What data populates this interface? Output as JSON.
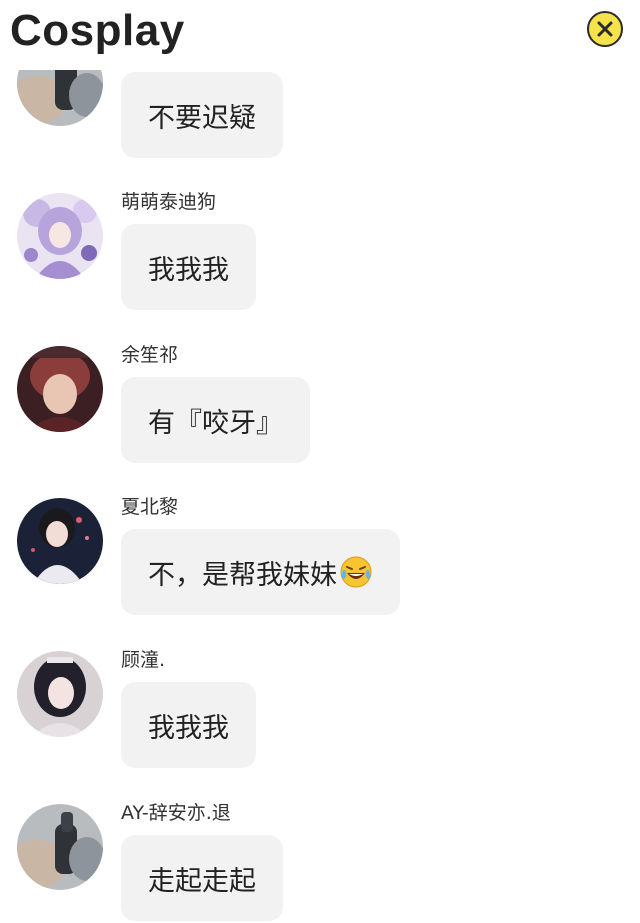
{
  "header": {
    "title": "Cosplay",
    "close_icon": "close-circle-icon"
  },
  "messages": [
    {
      "sender": "",
      "text": "不要迟疑",
      "avatar": "hand-figure-avatar"
    },
    {
      "sender": "萌萌泰迪狗",
      "text": "我我我",
      "avatar": "anime-girl-avatar"
    },
    {
      "sender": "余笙祁",
      "text": "有『咬牙』",
      "avatar": "red-hair-avatar"
    },
    {
      "sender": "夏北黎",
      "text": "不，是帮我妹妹",
      "emoji": "laughing-crying-emoji",
      "avatar": "white-dress-girl-avatar"
    },
    {
      "sender": "顾潼.",
      "text": "我我我",
      "avatar": "dark-hair-girl-avatar"
    },
    {
      "sender": "AY-辞安亦.退",
      "text": "走起走起",
      "avatar": "hand-figure-avatar"
    }
  ]
}
